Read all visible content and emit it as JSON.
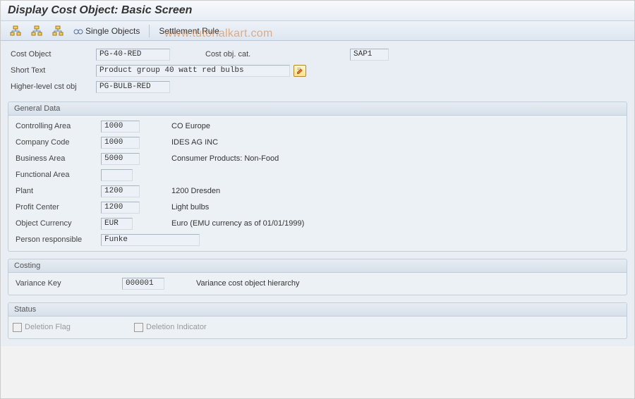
{
  "title": "Display Cost Object: Basic Screen",
  "watermark": "www.tutorialkart.com",
  "toolbar": {
    "single_objects": "Single Objects",
    "settlement_rule": "Settlement Rule"
  },
  "header": {
    "cost_object_lbl": "Cost Object",
    "cost_object_val": "PG-40-RED",
    "cost_obj_cat_lbl": "Cost obj. cat.",
    "cost_obj_cat_val": "SAP1",
    "short_text_lbl": "Short Text",
    "short_text_val": "Product group 40 watt red bulbs",
    "higher_lbl": "Higher-level cst obj",
    "higher_val": "PG-BULB-RED"
  },
  "general": {
    "title": "General Data",
    "controlling_area_lbl": "Controlling Area",
    "controlling_area_val": "1000",
    "controlling_area_desc": "CO Europe",
    "company_code_lbl": "Company Code",
    "company_code_val": "1000",
    "company_code_desc": "IDES AG INC",
    "business_area_lbl": "Business Area",
    "business_area_val": "5000",
    "business_area_desc": "Consumer Products: Non-Food",
    "functional_area_lbl": "Functional Area",
    "functional_area_val": "",
    "plant_lbl": "Plant",
    "plant_val": "1200",
    "plant_desc": "1200 Dresden",
    "profit_center_lbl": "Profit Center",
    "profit_center_val": "1200",
    "profit_center_desc": "Light bulbs",
    "object_currency_lbl": "Object Currency",
    "object_currency_val": "EUR",
    "object_currency_desc": "Euro (EMU currency as of 01/01/1999)",
    "person_resp_lbl": "Person responsible",
    "person_resp_val": "Funke"
  },
  "costing": {
    "title": "Costing",
    "variance_key_lbl": "Variance Key",
    "variance_key_val": "000001",
    "variance_key_desc": "Variance cost object hierarchy"
  },
  "status": {
    "title": "Status",
    "deletion_flag_lbl": "Deletion Flag",
    "deletion_ind_lbl": "Deletion Indicator"
  }
}
